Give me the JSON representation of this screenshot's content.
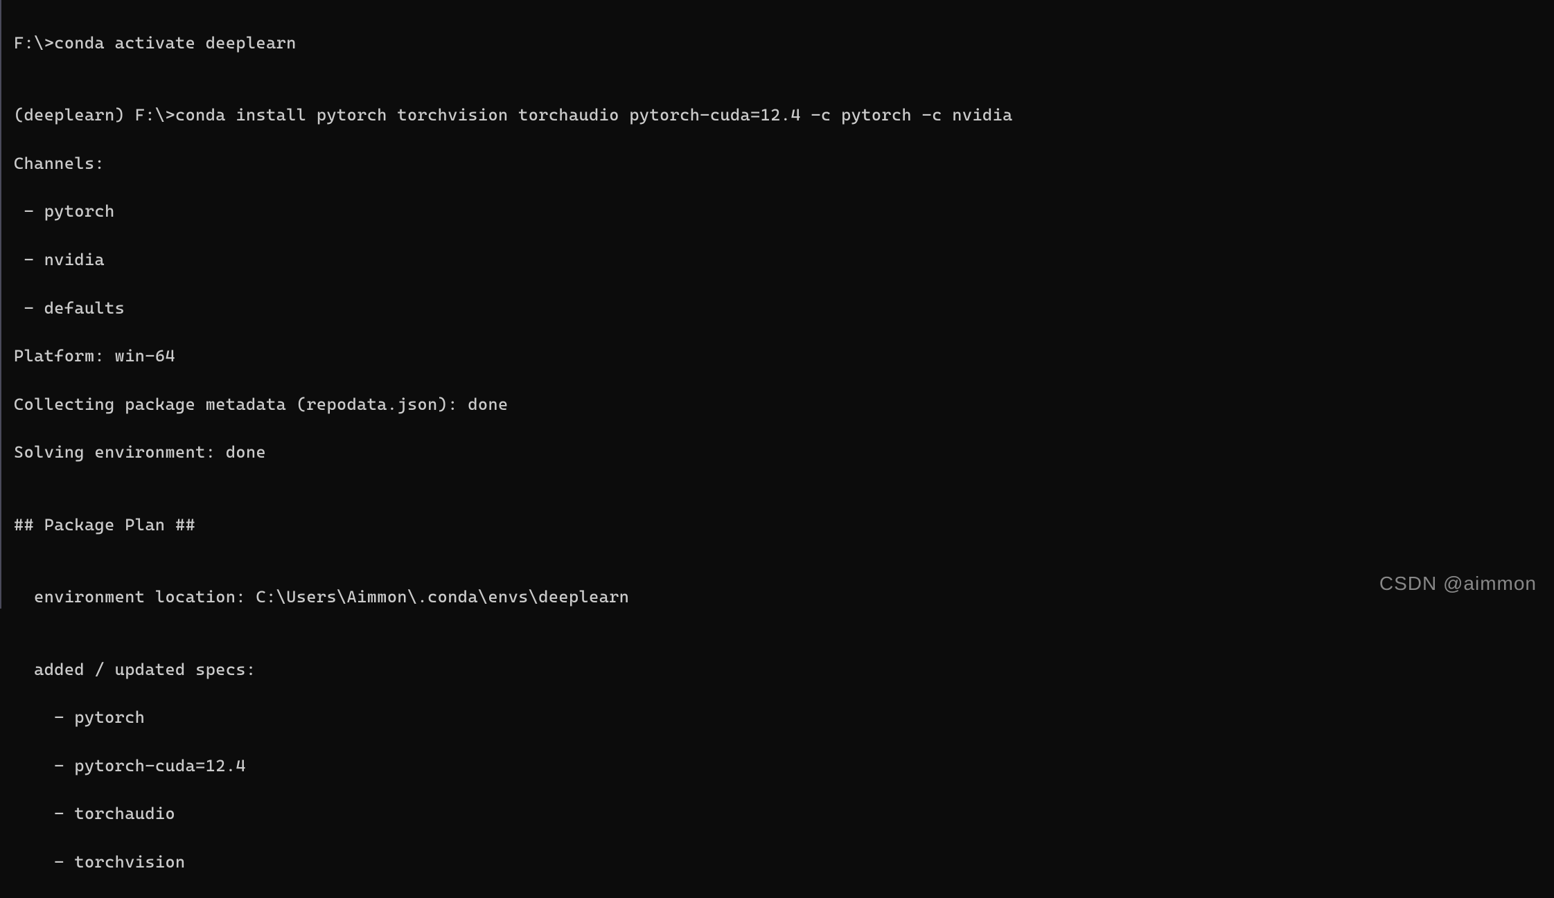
{
  "terminal": {
    "line1": "F:\\>conda activate deeplearn",
    "blank1": "",
    "line2": "(deeplearn) F:\\>conda install pytorch torchvision torchaudio pytorch-cuda=12.4 -c pytorch -c nvidia",
    "line3": "Channels:",
    "line4": " - pytorch",
    "line5": " - nvidia",
    "line6": " - defaults",
    "line7": "Platform: win-64",
    "line8": "Collecting package metadata (repodata.json): done",
    "line9": "Solving environment: done",
    "blank2": "",
    "line10": "## Package Plan ##",
    "blank3": "",
    "line11": "  environment location: C:\\Users\\Aimmon\\.conda\\envs\\deeplearn",
    "blank4": "",
    "line12": "  added / updated specs:",
    "line13": "    - pytorch",
    "line14": "    - pytorch-cuda=12.4",
    "line15": "    - torchaudio",
    "line16": "    - torchvision"
  },
  "watermark": "CSDN @aimmon"
}
